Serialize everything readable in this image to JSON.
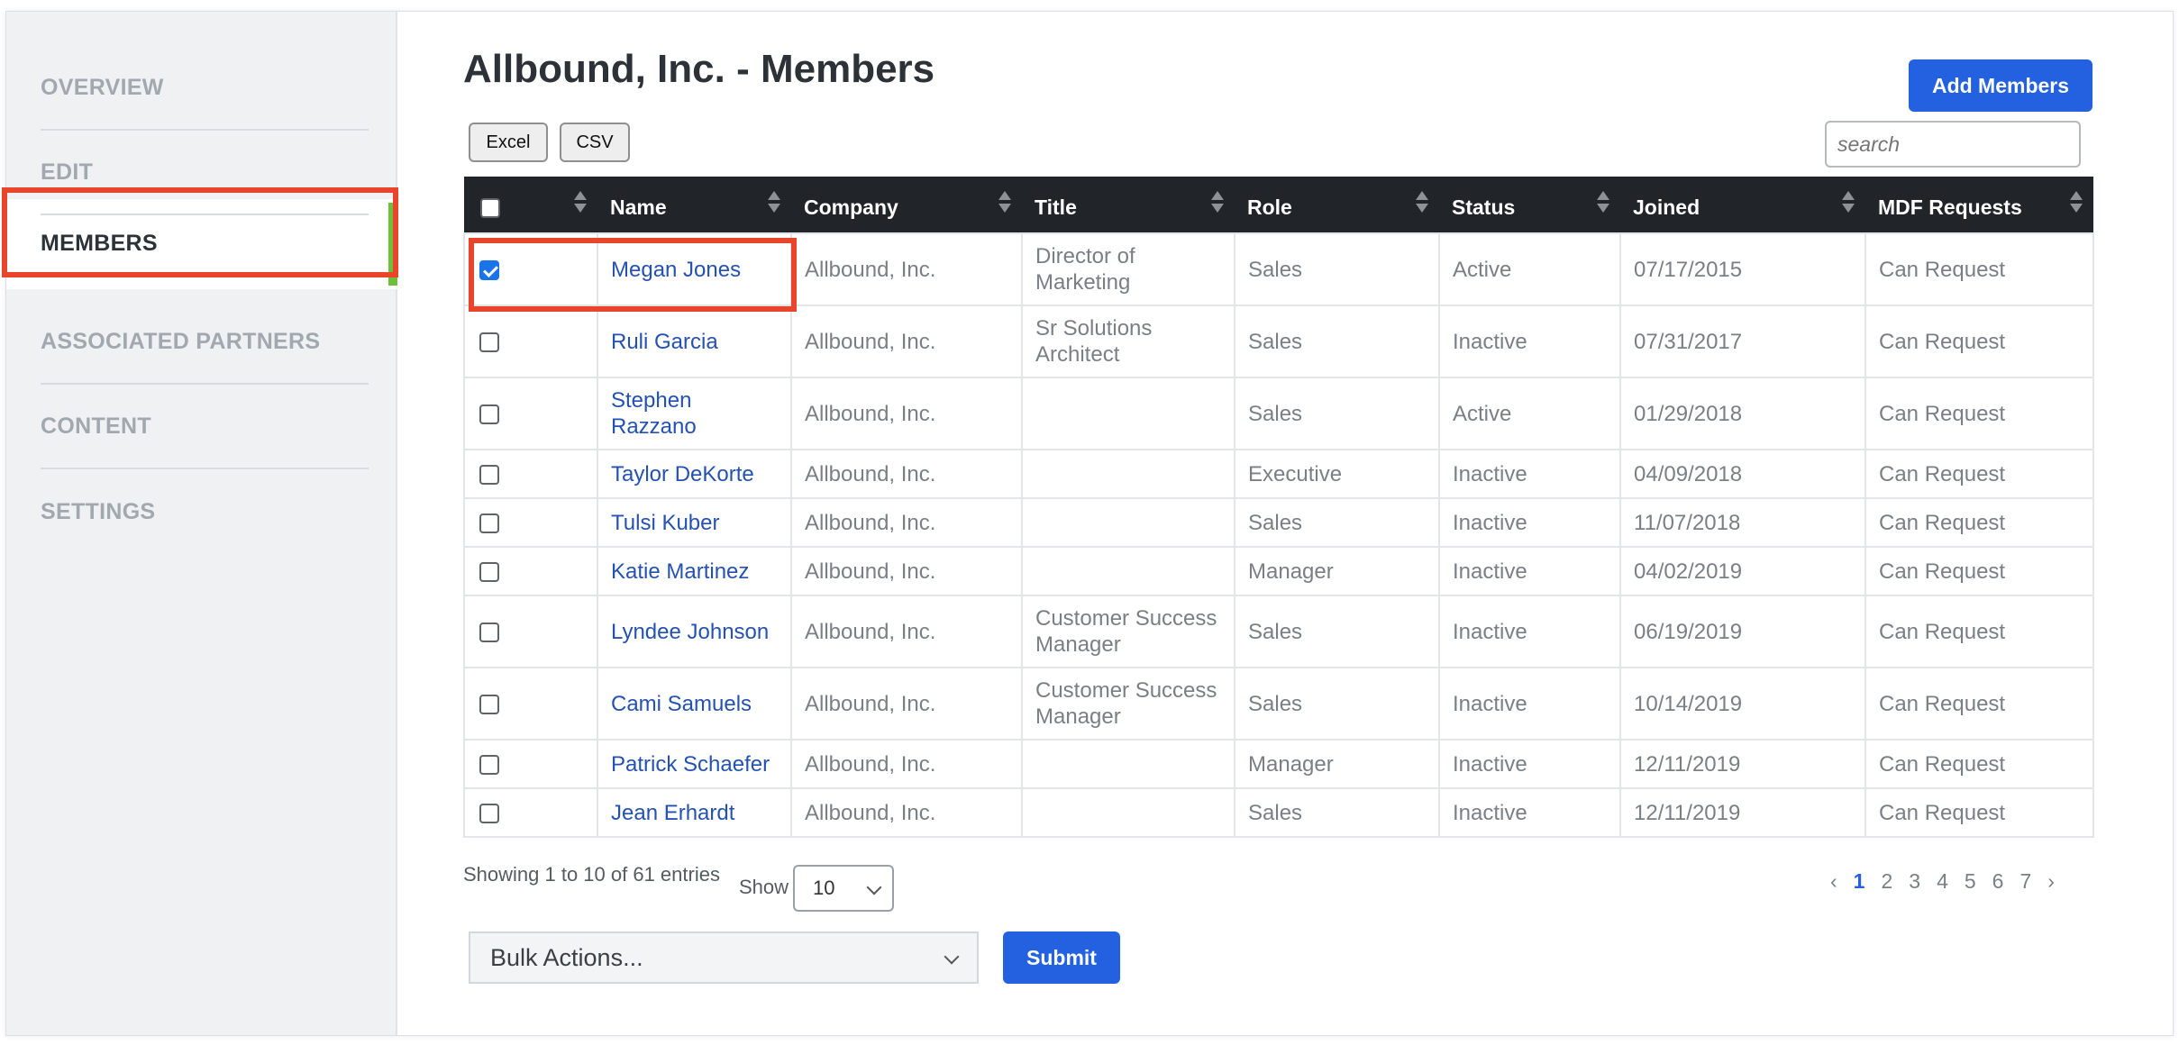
{
  "sidebar": {
    "items": [
      {
        "label": "OVERVIEW"
      },
      {
        "label": "EDIT"
      },
      {
        "label": "MEMBERS"
      },
      {
        "label": "ASSOCIATED PARTNERS"
      },
      {
        "label": "CONTENT"
      },
      {
        "label": "SETTINGS"
      }
    ],
    "active_index": 2,
    "active_color": "#6fbf3a"
  },
  "header": {
    "title": "Allbound, Inc. - Members",
    "add_button": "Add Members"
  },
  "toolbar": {
    "excel_label": "Excel",
    "csv_label": "CSV",
    "search_placeholder": "search"
  },
  "table": {
    "columns": [
      "Name",
      "Company",
      "Title",
      "Role",
      "Status",
      "Joined",
      "MDF Requests"
    ],
    "rows": [
      {
        "checked": true,
        "name": "Megan Jones",
        "company": "Allbound, Inc.",
        "title": "Director of Marketing",
        "role": "Sales",
        "status": "Active",
        "joined": "07/17/2015",
        "mdf": "Can Request"
      },
      {
        "checked": false,
        "name": "Ruli Garcia",
        "company": "Allbound, Inc.",
        "title": "Sr Solutions Architect",
        "role": "Sales",
        "status": "Inactive",
        "joined": "07/31/2017",
        "mdf": "Can Request"
      },
      {
        "checked": false,
        "name": "Stephen Razzano",
        "company": "Allbound, Inc.",
        "title": "",
        "role": "Sales",
        "status": "Active",
        "joined": "01/29/2018",
        "mdf": "Can Request"
      },
      {
        "checked": false,
        "name": "Taylor DeKorte",
        "company": "Allbound, Inc.",
        "title": "",
        "role": "Executive",
        "status": "Inactive",
        "joined": "04/09/2018",
        "mdf": "Can Request"
      },
      {
        "checked": false,
        "name": "Tulsi Kuber",
        "company": "Allbound, Inc.",
        "title": "",
        "role": "Sales",
        "status": "Inactive",
        "joined": "11/07/2018",
        "mdf": "Can Request"
      },
      {
        "checked": false,
        "name": "Katie Martinez",
        "company": "Allbound, Inc.",
        "title": "",
        "role": "Manager",
        "status": "Inactive",
        "joined": "04/02/2019",
        "mdf": "Can Request"
      },
      {
        "checked": false,
        "name": "Lyndee Johnson",
        "company": "Allbound, Inc.",
        "title": "Customer Success Manager",
        "role": "Sales",
        "status": "Inactive",
        "joined": "06/19/2019",
        "mdf": "Can Request"
      },
      {
        "checked": false,
        "name": "Cami Samuels",
        "company": "Allbound, Inc.",
        "title": "Customer Success Manager",
        "role": "Sales",
        "status": "Inactive",
        "joined": "10/14/2019",
        "mdf": "Can Request"
      },
      {
        "checked": false,
        "name": "Patrick Schaefer",
        "company": "Allbound, Inc.",
        "title": "",
        "role": "Manager",
        "status": "Inactive",
        "joined": "12/11/2019",
        "mdf": "Can Request"
      },
      {
        "checked": false,
        "name": "Jean Erhardt",
        "company": "Allbound, Inc.",
        "title": "",
        "role": "Sales",
        "status": "Inactive",
        "joined": "12/11/2019",
        "mdf": "Can Request"
      }
    ]
  },
  "footer": {
    "entries_info": "Showing 1 to 10 of 61 entries",
    "show_label": "Show",
    "show_value": "10",
    "pages": [
      "1",
      "2",
      "3",
      "4",
      "5",
      "6",
      "7"
    ],
    "current_page": "1",
    "prev_symbol": "‹",
    "next_symbol": "›",
    "bulk_actions": "Bulk Actions...",
    "submit_label": "Submit"
  },
  "colors": {
    "primary": "#2461e0",
    "highlight": "#e8452c",
    "header_bg": "#212529",
    "link": "#2451b2"
  }
}
